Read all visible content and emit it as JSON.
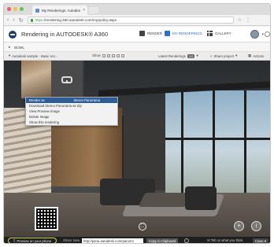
{
  "browser": {
    "tab_title": "My Renderings: Autodesk",
    "tab_close": "×",
    "url_protocol": "https",
    "url_rest": "://rendering.360.autodesk.com/myrpolicy.aspx",
    "back_glyph": "‹",
    "forward_glyph": "›",
    "reload_glyph": "↻",
    "star_glyph": "☆",
    "menu_glyph": "⋮"
  },
  "app": {
    "title": "Rendering in AUTODESK® A360",
    "nav": [
      {
        "label": "RENDER",
        "icon": "render-icon"
      },
      {
        "label": "MY RENDERINGS",
        "icon": "renderings-icon"
      },
      {
        "label": "GALLERY",
        "icon": "gallery-grid-icon"
      }
    ],
    "colors": {
      "accent": "#2b73c9",
      "highlight_ring": "#c9d95a",
      "menu_header": "#2f5d98"
    }
  },
  "breadcrumb": {
    "glyph": "▸",
    "label": "BOML"
  },
  "toolbar": {
    "project_label": "Autodesk sample - Basic ren...",
    "show_label": "Show",
    "latest_label": "Latest Renderings",
    "latest_count": "1/2",
    "share_label": "Share project",
    "actions_label": "Actions"
  },
  "context_menu": {
    "header_left": "Render as",
    "header_right": "Stereo Panorama",
    "items": [
      "Download Stereo Panorama as Zip",
      "View Preview Image",
      "Delete Image",
      "Show this rendering"
    ]
  },
  "viewer": {
    "expand_glyph": "⛶",
    "plus_glyph": "+",
    "info_glyph": "i"
  },
  "bottombar": {
    "preview_label": "Preview on your phone",
    "share_label": "Share Now",
    "share_url": "http://panu.autodesk.com/panorm",
    "copy_label": "Copy to Clipboard",
    "tell_label": "Tell us what you think",
    "close_label": "Close"
  }
}
